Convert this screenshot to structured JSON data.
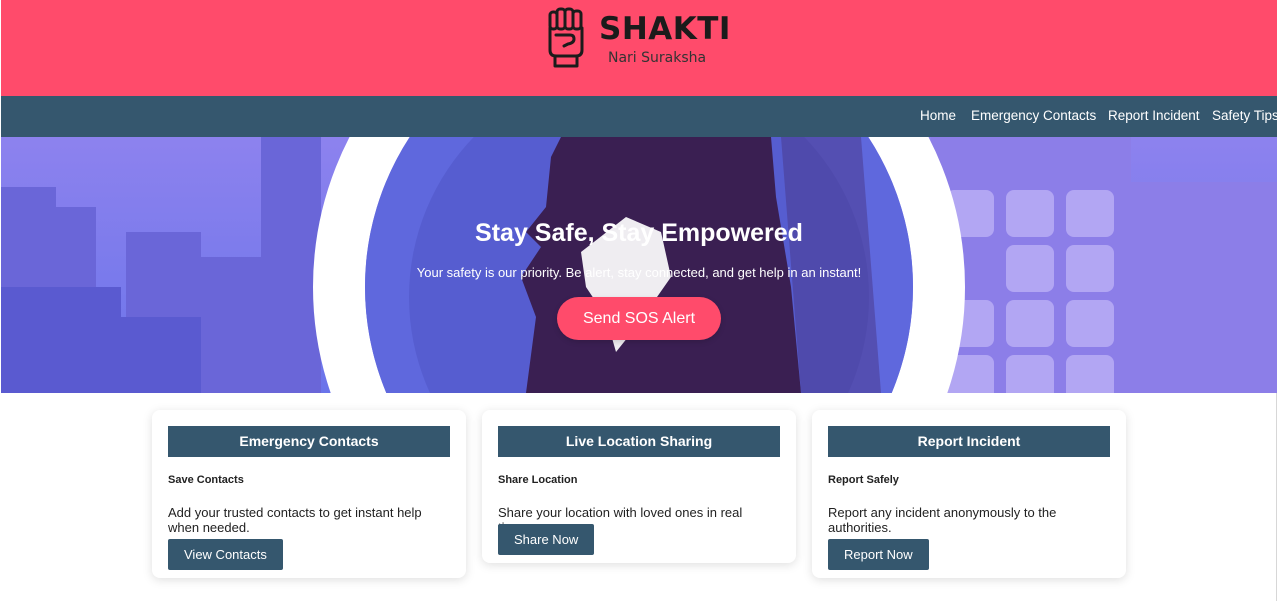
{
  "header": {
    "brand_name": "SHAKTI",
    "tagline": "Nari Suraksha",
    "logo_icon": "raised-fist-icon",
    "background_color": "#ff4b6b"
  },
  "nav": {
    "items": [
      {
        "label": "Home"
      },
      {
        "label": "Emergency Contacts"
      },
      {
        "label": "Report Incident"
      },
      {
        "label": "Safety Tips"
      }
    ],
    "background_color": "#35576e"
  },
  "hero": {
    "title": "Stay Safe, Stay Empowered",
    "subtitle": "Your safety is our priority. Be alert, stay connected, and get help in an instant!",
    "button_label": "Send SOS Alert",
    "accent_color": "#ff4b6b"
  },
  "cards": [
    {
      "title": "Emergency Contacts",
      "subtitle": "Save Contacts",
      "description": "Add your trusted contacts to get instant help when needed.",
      "button_label": "View Contacts"
    },
    {
      "title": "Live Location Sharing",
      "subtitle": "Share Location",
      "description": "Share your location with loved ones in real time.",
      "button_label": "Share Now"
    },
    {
      "title": "Report Incident",
      "subtitle": "Report Safely",
      "description": "Report any incident anonymously to the authorities.",
      "button_label": "Report Now"
    }
  ]
}
